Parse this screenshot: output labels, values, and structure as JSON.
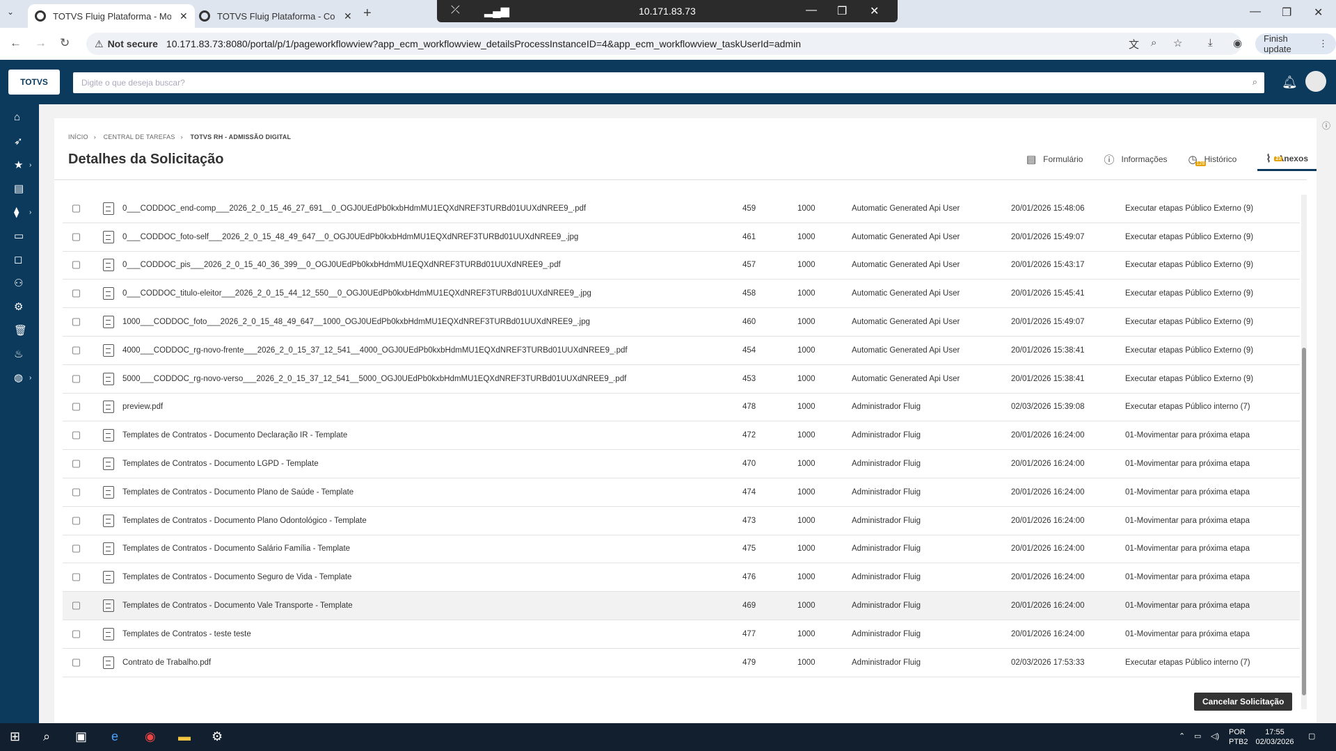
{
  "browser": {
    "tabs": [
      {
        "title": "TOTVS Fluig Plataforma - Movi",
        "active": true
      },
      {
        "title": "TOTVS Fluig Plataforma - Comp",
        "active": false
      }
    ],
    "not_secure": "Not secure",
    "url": "10.171.83.73:8080/portal/p/1/pageworkflowview?app_ecm_workflowview_detailsProcessInstanceID=4&app_ecm_workflowview_taskUserId=admin",
    "finish_update": "Finish update"
  },
  "remote": {
    "ip": "10.171.83.73"
  },
  "app": {
    "logo": "TOTVS",
    "search_placeholder": "Digite o que deseja buscar?"
  },
  "breadcrumb": [
    "INÍCIO",
    "CENTRAL DE TAREFAS",
    "TOTVS RH - ADMISSÃO DIGITAL"
  ],
  "page_title": "Detalhes da Solicitação",
  "page_tabs": [
    {
      "label": "Formulário",
      "icon": "form-icon",
      "badge": ""
    },
    {
      "label": "Informações",
      "icon": "info-icon",
      "badge": ""
    },
    {
      "label": "Histórico",
      "icon": "clock-icon",
      "badge": "128"
    },
    {
      "label": "Anexos",
      "icon": "paperclip-icon",
      "badge": "23"
    }
  ],
  "attachments": [
    {
      "name": "0___CODDOC_end-comp___2026_2_0_15_46_27_691__0_OGJ0UEdPb0kxbHdmMU1EQXdNREF3TURBd01UUXdNREE9_.pdf",
      "id": "459",
      "version": "1000",
      "user": "Automatic Generated Api User",
      "date": "20/01/2026 15:48:06",
      "step": "Executar etapas Público Externo (9)"
    },
    {
      "name": "0___CODDOC_foto-self___2026_2_0_15_48_49_647__0_OGJ0UEdPb0kxbHdmMU1EQXdNREF3TURBd01UUXdNREE9_.jpg",
      "id": "461",
      "version": "1000",
      "user": "Automatic Generated Api User",
      "date": "20/01/2026 15:49:07",
      "step": "Executar etapas Público Externo (9)"
    },
    {
      "name": "0___CODDOC_pis___2026_2_0_15_40_36_399__0_OGJ0UEdPb0kxbHdmMU1EQXdNREF3TURBd01UUXdNREE9_.pdf",
      "id": "457",
      "version": "1000",
      "user": "Automatic Generated Api User",
      "date": "20/01/2026 15:43:17",
      "step": "Executar etapas Público Externo (9)"
    },
    {
      "name": "0___CODDOC_titulo-eleitor___2026_2_0_15_44_12_550__0_OGJ0UEdPb0kxbHdmMU1EQXdNREF3TURBd01UUXdNREE9_.jpg",
      "id": "458",
      "version": "1000",
      "user": "Automatic Generated Api User",
      "date": "20/01/2026 15:45:41",
      "step": "Executar etapas Público Externo (9)"
    },
    {
      "name": "1000___CODDOC_foto___2026_2_0_15_48_49_647__1000_OGJ0UEdPb0kxbHdmMU1EQXdNREF3TURBd01UUXdNREE9_.jpg",
      "id": "460",
      "version": "1000",
      "user": "Automatic Generated Api User",
      "date": "20/01/2026 15:49:07",
      "step": "Executar etapas Público Externo (9)"
    },
    {
      "name": "4000___CODDOC_rg-novo-frente___2026_2_0_15_37_12_541__4000_OGJ0UEdPb0kxbHdmMU1EQXdNREF3TURBd01UUXdNREE9_.pdf",
      "id": "454",
      "version": "1000",
      "user": "Automatic Generated Api User",
      "date": "20/01/2026 15:38:41",
      "step": "Executar etapas Público Externo (9)"
    },
    {
      "name": "5000___CODDOC_rg-novo-verso___2026_2_0_15_37_12_541__5000_OGJ0UEdPb0kxbHdmMU1EQXdNREF3TURBd01UUXdNREE9_.pdf",
      "id": "453",
      "version": "1000",
      "user": "Automatic Generated Api User",
      "date": "20/01/2026 15:38:41",
      "step": "Executar etapas Público Externo (9)"
    },
    {
      "name": "preview.pdf",
      "id": "478",
      "version": "1000",
      "user": "Administrador Fluig",
      "date": "02/03/2026 15:39:08",
      "step": "Executar etapas Público interno (7)"
    },
    {
      "name": "Templates de Contratos - Documento Declaração IR - Template",
      "id": "472",
      "version": "1000",
      "user": "Administrador Fluig",
      "date": "20/01/2026 16:24:00",
      "step": "01-Movimentar para próxima etapa"
    },
    {
      "name": "Templates de Contratos - Documento LGPD - Template",
      "id": "470",
      "version": "1000",
      "user": "Administrador Fluig",
      "date": "20/01/2026 16:24:00",
      "step": "01-Movimentar para próxima etapa"
    },
    {
      "name": "Templates de Contratos - Documento Plano de Saúde - Template",
      "id": "474",
      "version": "1000",
      "user": "Administrador Fluig",
      "date": "20/01/2026 16:24:00",
      "step": "01-Movimentar para próxima etapa"
    },
    {
      "name": "Templates de Contratos - Documento Plano Odontológico - Template",
      "id": "473",
      "version": "1000",
      "user": "Administrador Fluig",
      "date": "20/01/2026 16:24:00",
      "step": "01-Movimentar para próxima etapa"
    },
    {
      "name": "Templates de Contratos - Documento Salário Família - Template",
      "id": "475",
      "version": "1000",
      "user": "Administrador Fluig",
      "date": "20/01/2026 16:24:00",
      "step": "01-Movimentar para próxima etapa"
    },
    {
      "name": "Templates de Contratos - Documento Seguro de Vida - Template",
      "id": "476",
      "version": "1000",
      "user": "Administrador Fluig",
      "date": "20/01/2026 16:24:00",
      "step": "01-Movimentar para próxima etapa"
    },
    {
      "name": "Templates de Contratos - Documento Vale Transporte - Template",
      "id": "469",
      "version": "1000",
      "user": "Administrador Fluig",
      "date": "20/01/2026 16:24:00",
      "step": "01-Movimentar para próxima etapa"
    },
    {
      "name": "Templates de Contratos - teste teste",
      "id": "477",
      "version": "1000",
      "user": "Administrador Fluig",
      "date": "20/01/2026 16:24:00",
      "step": "01-Movimentar para próxima etapa"
    },
    {
      "name": "Contrato de Trabalho.pdf",
      "id": "479",
      "version": "1000",
      "user": "Administrador Fluig",
      "date": "02/03/2026 17:53:33",
      "step": "Executar etapas Público interno (7)"
    }
  ],
  "cancel_button": "Cancelar Solicitação",
  "taskbar": {
    "lang": "POR",
    "layout": "PTB2",
    "time": "17:55",
    "date": "02/03/2026"
  }
}
